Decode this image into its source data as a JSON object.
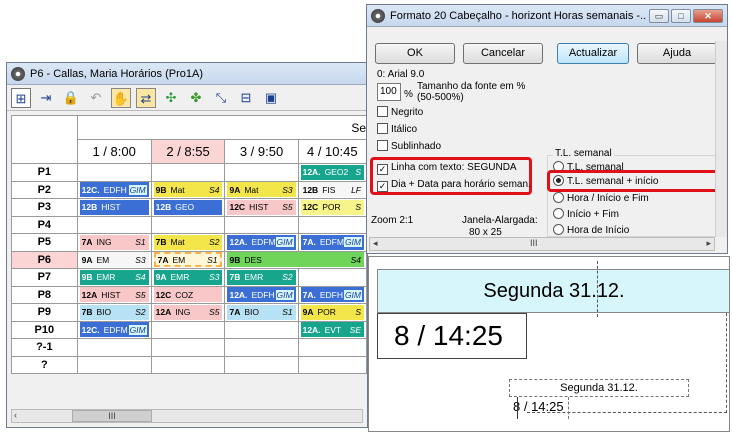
{
  "left_window": {
    "title": "P6 - Callas, Maria  Horários (Pro1A)",
    "toolbar_icons": [
      "grid-icon",
      "export-icon",
      "lock-icon",
      "undo-icon",
      "hand-icon",
      "swap-icon",
      "puzzle-icon",
      "plugins-icon",
      "move-icon",
      "split-icon",
      "window-icon"
    ],
    "header_partial": "Se",
    "columns": [
      "1 / 8:00",
      "2 / 8:55",
      "3 / 9:50",
      "4 / 10:45"
    ],
    "rows": [
      {
        "label": "P1",
        "cells": [
          null,
          null,
          null,
          {
            "bold": "12A.",
            "text": "GEO2",
            "sub": "S"
          }
        ]
      },
      {
        "label": "P2",
        "cells": [
          {
            "bold": "12C.",
            "text": "EDFH",
            "sub": "GIM"
          },
          {
            "bold": "9B",
            "text": "Mat",
            "sub": "S4"
          },
          {
            "bold": "9A",
            "text": "Mat",
            "sub": "S3"
          },
          {
            "bold": "12B",
            "text": "FIS",
            "sub": "LF"
          }
        ]
      },
      {
        "label": "P3",
        "cells": [
          {
            "bold": "12B",
            "text": "HIST"
          },
          {
            "bold": "12B",
            "text": "GEO"
          },
          {
            "bold": "12C",
            "text": "HIST",
            "sub": "S5"
          },
          {
            "bold": "12C",
            "text": "POR",
            "sub": "S"
          }
        ]
      },
      {
        "label": "P4",
        "cells": [
          null,
          null,
          null,
          null
        ]
      },
      {
        "label": "P5",
        "cells": [
          {
            "bold": "7A",
            "text": "ING",
            "sub": "S1"
          },
          {
            "bold": "7B",
            "text": "Mat",
            "sub": "S2"
          },
          {
            "bold": "12A.",
            "text": "EDFM",
            "sub": "GIM"
          },
          {
            "bold": "7A.",
            "text": "EDFM",
            "sub": "GIM"
          }
        ]
      },
      {
        "label": "P6",
        "cells": [
          {
            "bold": "9A",
            "text": "EM",
            "sub": "S3"
          },
          {
            "bold": "7A",
            "text": "EM",
            "sub": "S1"
          },
          {
            "bold": "9B",
            "text": "DES",
            "sub": "S4"
          },
          null
        ]
      },
      {
        "label": "P7",
        "cells": [
          {
            "bold": "9B",
            "text": "EMR",
            "sub": "S4"
          },
          {
            "bold": "9A",
            "text": "EMR",
            "sub": "S3"
          },
          {
            "bold": "7B",
            "text": "EMR",
            "sub": "S2"
          },
          null
        ]
      },
      {
        "label": "P8",
        "cells": [
          {
            "bold": "12A",
            "text": "HIST",
            "sub": "S5"
          },
          {
            "bold": "12C",
            "text": "COZ"
          },
          {
            "bold": "12A.",
            "text": "EDFH",
            "sub": "GIM"
          },
          {
            "bold": "7A.",
            "text": "EDFH",
            "sub": "GIM"
          }
        ]
      },
      {
        "label": "P9",
        "cells": [
          {
            "bold": "7B",
            "text": "BIO",
            "sub": "S2"
          },
          {
            "bold": "12A",
            "text": "ING",
            "sub": "S5"
          },
          {
            "bold": "7A",
            "text": "BIO",
            "sub": "S1"
          },
          {
            "bold": "9A",
            "text": "POR",
            "sub": "S"
          }
        ]
      },
      {
        "label": "P10",
        "cells": [
          {
            "bold": "12C.",
            "text": "EDFM",
            "sub": "GIM"
          },
          null,
          null,
          {
            "bold": "12A.",
            "text": "EVT",
            "sub": "SE"
          }
        ]
      },
      {
        "label": "?-1",
        "cells": [
          null,
          null,
          null,
          null
        ]
      },
      {
        "label": "?",
        "cells": [
          null,
          null,
          null,
          null
        ]
      }
    ],
    "scroll_label": "III"
  },
  "dialog": {
    "title": "Formato 20  Cabeçalho - horizont  Horas semanais -...",
    "buttons": {
      "ok": "OK",
      "cancel": "Cancelar",
      "update": "Actualizar",
      "help": "Ajuda"
    },
    "font_label": "0: Arial 9.0",
    "font_size_value": "100",
    "font_size_pct": "%",
    "font_size_caption": "Tamanho da fonte em % (50-500%)",
    "checkboxes": {
      "bold": "Negrito",
      "italic": "Itálico",
      "underline": "Sublinhado",
      "line_text": "Linha com texto: SEGUNDA",
      "day_date": "Dia + Data para horário seman."
    },
    "group_title": "T.L. semanal",
    "radios": {
      "r1": "T.L. semanal",
      "r2": "T.L. semanal + início",
      "r3": "Hora / Início e Fim",
      "r4": "Início + Fim",
      "r5": "Hora de Início"
    },
    "zoom": "Zoom  2:1",
    "window_wide": "Janela-Alargada:",
    "window_wide_value": "80 x 25",
    "scroll_label": "III"
  },
  "preview": {
    "big_header": "Segunda 31.12.",
    "big_time": "8 / 14:25",
    "small_header": "Segunda 31.12.",
    "small_time": "8 / 14:25"
  },
  "colors": {
    "yellow": "#f3e64a",
    "blue": "#3b6fd6",
    "green": "#6fd45a",
    "lightblue": "#b7e1f4",
    "red": "#e0101a",
    "pink": "#f8c8c8",
    "cyan": "#d6f6fb",
    "teal": "#17a58d",
    "orange": "#ffb347",
    "light_yellow": "#f7f48b"
  }
}
